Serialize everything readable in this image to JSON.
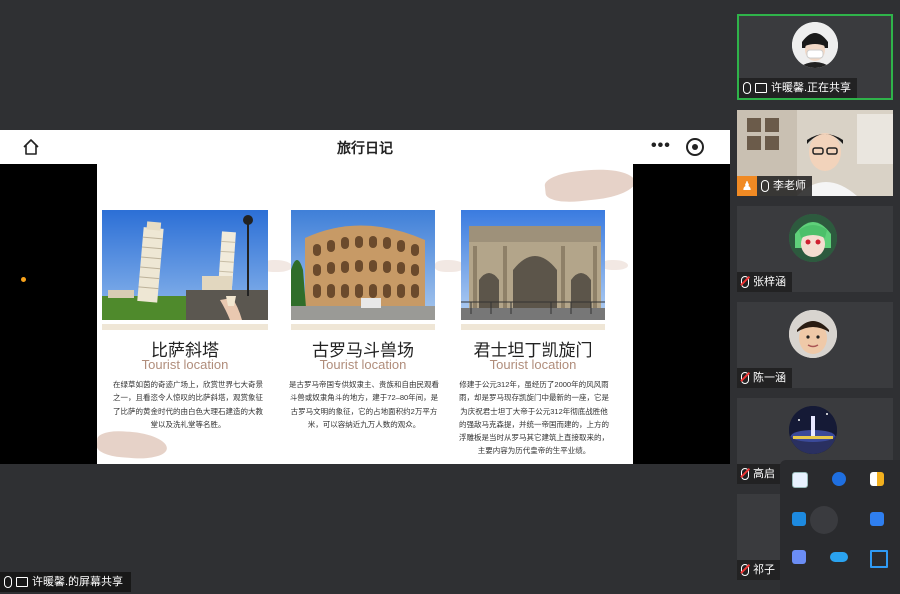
{
  "share_window": {
    "title": "旅行日记",
    "more": "•••"
  },
  "slide": {
    "cards": [
      {
        "title": "比萨斜塔",
        "subtitle": "Tourist location",
        "description": "在绿草如茵的奇迹广场上，欣赏世界七大奇景之一，且看恣令人惊叹的比萨斜塔，观赏象征了比萨的黄金时代的由白色大理石建造的大教堂以及洗礼堂等名胜。"
      },
      {
        "title": "古罗马斗兽场",
        "subtitle": "Tourist location",
        "description": "是古罗马帝国专供奴隶主、贵族和自由民观看斗兽或奴隶角斗的地方，建于72–80年间，是古罗马文明的象征，它的占地面积约2万平方米，可以容纳近九万人数的观众。"
      },
      {
        "title": "君士坦丁凯旋门",
        "subtitle": "Tourist location",
        "description": "修建于公元312年，虽经历了2000年的风风雨雨，却是罗马现存凯旋门中最新的一座，它是为庆祝君士坦丁大帝于公元312年彻底战胜他的强敌马克森提，并统一帝国而建的，上方的浮雕板是当时从罗马其它建筑上直接取来的，主要内容为历代皇帝的生平业绩。"
      }
    ]
  },
  "participants": [
    {
      "name": "许暖馨.正在共享",
      "sharing": true,
      "mic": "on",
      "active": true
    },
    {
      "name": "李老师",
      "mic": "on"
    },
    {
      "name": "张梓涵",
      "mic": "off"
    },
    {
      "name": "陈一涵",
      "mic": "off"
    },
    {
      "name": "高启",
      "mic": "off"
    },
    {
      "name": "祁子",
      "mic": "off"
    }
  ],
  "bottom_bar": {
    "label": "许暖馨.的屏幕共享"
  },
  "colors": {
    "accent_green": "#2fb34a",
    "brush": "#d5b4a3",
    "subtitle": "#b08d7b"
  }
}
